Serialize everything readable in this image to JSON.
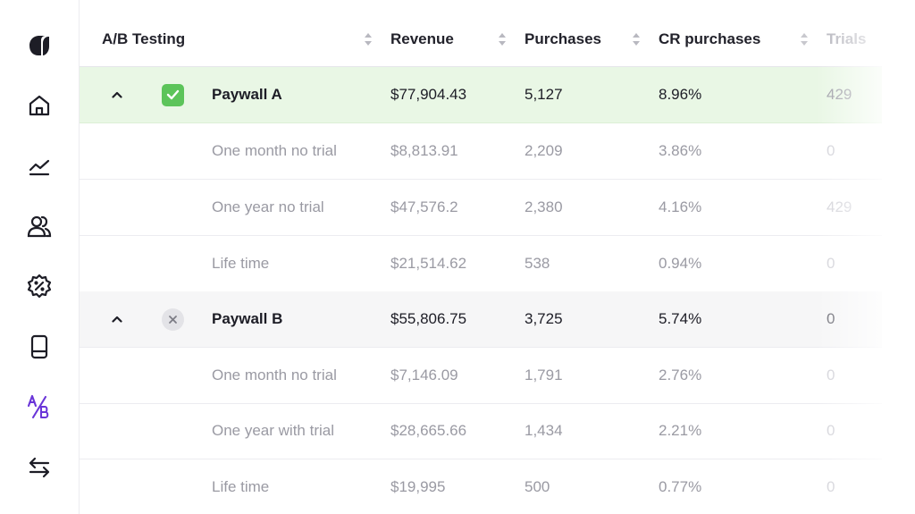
{
  "header": {
    "title": "A/B Testing",
    "columns": {
      "revenue": "Revenue",
      "purchases": "Purchases",
      "cr": "CR purchases",
      "trials": "Trials"
    }
  },
  "sidebar": {
    "items": [
      {
        "icon": "logo-icon"
      },
      {
        "icon": "home-icon"
      },
      {
        "icon": "analytics-icon"
      },
      {
        "icon": "users-icon"
      },
      {
        "icon": "discount-icon"
      },
      {
        "icon": "device-icon"
      },
      {
        "icon": "ab-test-icon",
        "active": true
      },
      {
        "icon": "transfer-icon"
      }
    ]
  },
  "colors": {
    "accent": "#6a35d8",
    "success": "#5cc45a",
    "paywall_a_bg": "#e9f7e5",
    "paywall_b_bg": "#f6f6f7"
  },
  "rows": [
    {
      "name": "Paywall A",
      "revenue": "$77,904.43",
      "purchases": "5,127",
      "cr": "8.96%",
      "trials": "429"
    },
    {
      "name": "One month no trial",
      "revenue": "$8,813.91",
      "purchases": "2,209",
      "cr": "3.86%",
      "trials": "0"
    },
    {
      "name": "One year no trial",
      "revenue": "$47,576.2",
      "purchases": "2,380",
      "cr": "4.16%",
      "trials": "429"
    },
    {
      "name": "Life time",
      "revenue": "$21,514.62",
      "purchases": "538",
      "cr": "0.94%",
      "trials": "0"
    },
    {
      "name": "Paywall B",
      "revenue": "$55,806.75",
      "purchases": "3,725",
      "cr": "5.74%",
      "trials": "0"
    },
    {
      "name": "One month no trial",
      "revenue": "$7,146.09",
      "purchases": "1,791",
      "cr": "2.76%",
      "trials": "0"
    },
    {
      "name": "One year with trial",
      "revenue": "$28,665.66",
      "purchases": "1,434",
      "cr": "2.21%",
      "trials": "0"
    },
    {
      "name": "Life time",
      "revenue": "$19,995",
      "purchases": "500",
      "cr": "0.77%",
      "trials": "0"
    }
  ]
}
